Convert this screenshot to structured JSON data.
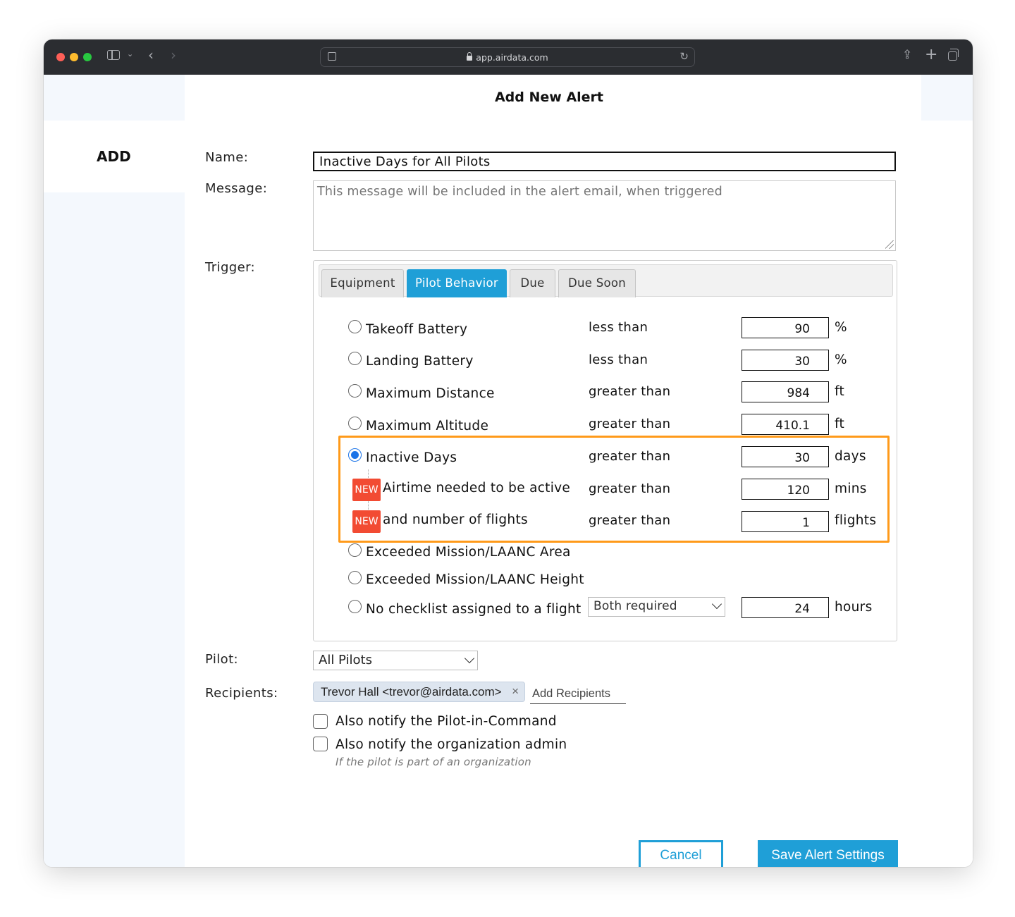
{
  "browser": {
    "url": "app.airdata.com"
  },
  "sidebar": {
    "section_label": "ADD"
  },
  "dialog": {
    "title": "Add New Alert"
  },
  "form": {
    "name_label": "Name:",
    "name_value": "Inactive Days for All Pilots",
    "message_label": "Message:",
    "message_placeholder": "This message will be included in the alert email, when triggered",
    "trigger_label": "Trigger:",
    "pilot_label": "Pilot:",
    "pilot_value": "All Pilots",
    "recipients_label": "Recipients:",
    "recipient_chip": "Trevor Hall <trevor@airdata.com>",
    "recipient_remove": "×",
    "add_recipients_placeholder": "Add Recipients",
    "notify_pic_label": "Also notify the Pilot-in-Command",
    "notify_admin_label": "Also notify the organization admin",
    "notify_admin_hint": "If the pilot is part of an organization"
  },
  "trigger": {
    "tabs": [
      {
        "label": "Equipment",
        "active": false
      },
      {
        "label": "Pilot Behavior",
        "active": true
      },
      {
        "label": "Due",
        "active": false
      },
      {
        "label": "Due Soon",
        "active": false
      }
    ],
    "badge_label": "NEW",
    "rows": [
      {
        "label": "Takeoff Battery",
        "comparator": "less than",
        "value": "90",
        "unit": "%",
        "selected": false
      },
      {
        "label": "Landing Battery",
        "comparator": "less than",
        "value": "30",
        "unit": "%",
        "selected": false
      },
      {
        "label": "Maximum Distance",
        "comparator": "greater than",
        "value": "984",
        "unit": "ft",
        "selected": false
      },
      {
        "label": "Maximum Altitude",
        "comparator": "greater than",
        "value": "410.1",
        "unit": "ft",
        "selected": false
      },
      {
        "label": "Inactive Days",
        "comparator": "greater than",
        "value": "30",
        "unit": "days",
        "selected": true
      },
      {
        "label": "Airtime needed to be active",
        "comparator": "greater than",
        "value": "120",
        "unit": "mins",
        "new": true
      },
      {
        "label": "and number of flights",
        "comparator": "greater than",
        "value": "1",
        "unit": "flights",
        "new": true
      },
      {
        "label": "Exceeded Mission/LAANC Area",
        "selected": false
      },
      {
        "label": "Exceeded Mission/LAANC Height",
        "selected": false
      },
      {
        "label": "No checklist assigned to a flight",
        "select_value": "Both required",
        "value": "24",
        "unit": "hours",
        "selected": false
      }
    ]
  },
  "actions": {
    "cancel_label": "Cancel",
    "save_label": "Save Alert Settings"
  },
  "colors": {
    "accent": "#1f9fd7",
    "highlight": "#ff9a1a",
    "new_badge": "#f24b33",
    "radio_selected": "#1a73e8"
  }
}
